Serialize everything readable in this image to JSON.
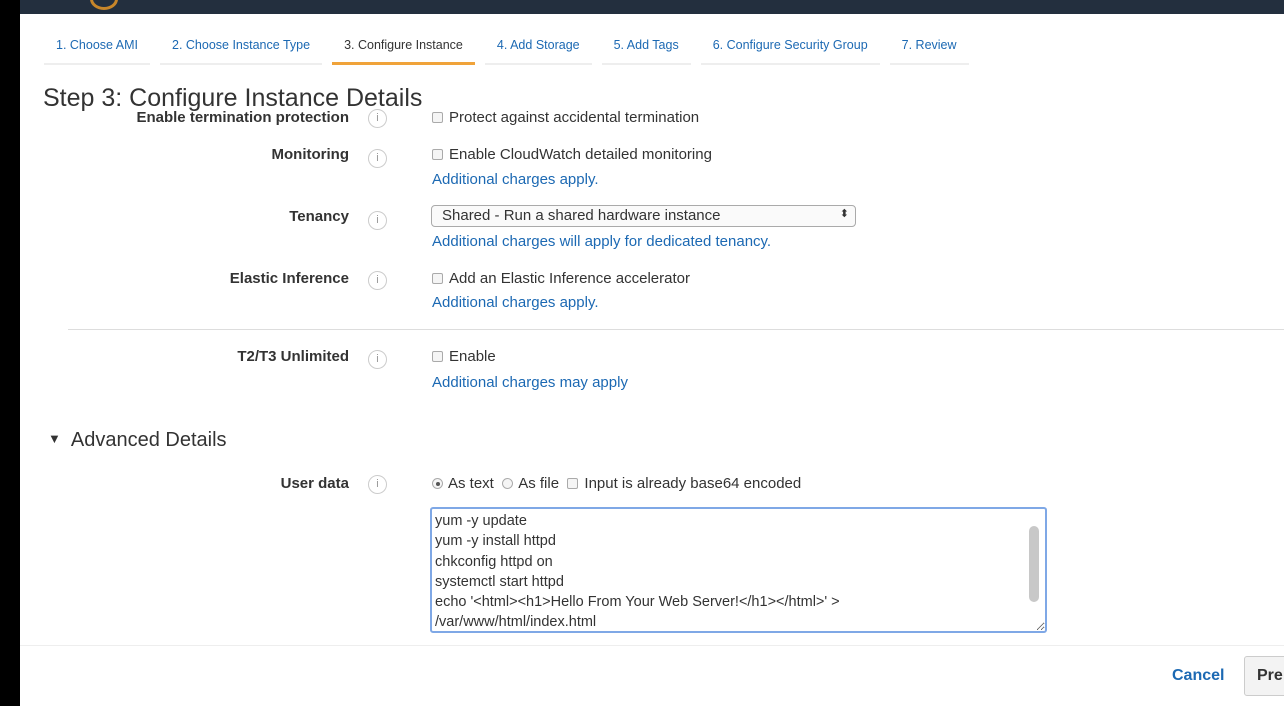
{
  "tabs": [
    "1. Choose AMI",
    "2. Choose Instance Type",
    "3. Configure Instance",
    "4. Add Storage",
    "5. Add Tags",
    "6. Configure Security Group",
    "7. Review"
  ],
  "active_tab": 2,
  "title": "Step 3: Configure Instance Details",
  "termination": {
    "label": "Enable termination protection",
    "option": "Protect against accidental termination"
  },
  "monitoring": {
    "label": "Monitoring",
    "option": "Enable CloudWatch detailed monitoring",
    "note": "Additional charges apply."
  },
  "tenancy": {
    "label": "Tenancy",
    "value": "Shared - Run a shared hardware instance",
    "note": "Additional charges will apply for dedicated tenancy."
  },
  "elastic": {
    "label": "Elastic Inference",
    "option": "Add an Elastic Inference accelerator",
    "note": "Additional charges apply."
  },
  "t2t3": {
    "label": "T2/T3 Unlimited",
    "option": "Enable",
    "note": "Additional charges may apply"
  },
  "advanced": {
    "heading": "Advanced Details"
  },
  "user_data": {
    "label": "User data",
    "as_text": "As text",
    "as_file": "As file",
    "base64": "Input is already base64 encoded",
    "value": "yum -y update\nyum -y install httpd\nchkconfig httpd on\nsystemctl start httpd\necho '<html><h1>Hello From Your Web Server!</h1></html>' >\n/var/www/html/index.html"
  },
  "info_glyph": "i",
  "footer": {
    "cancel": "Cancel",
    "previous": "Pre"
  }
}
